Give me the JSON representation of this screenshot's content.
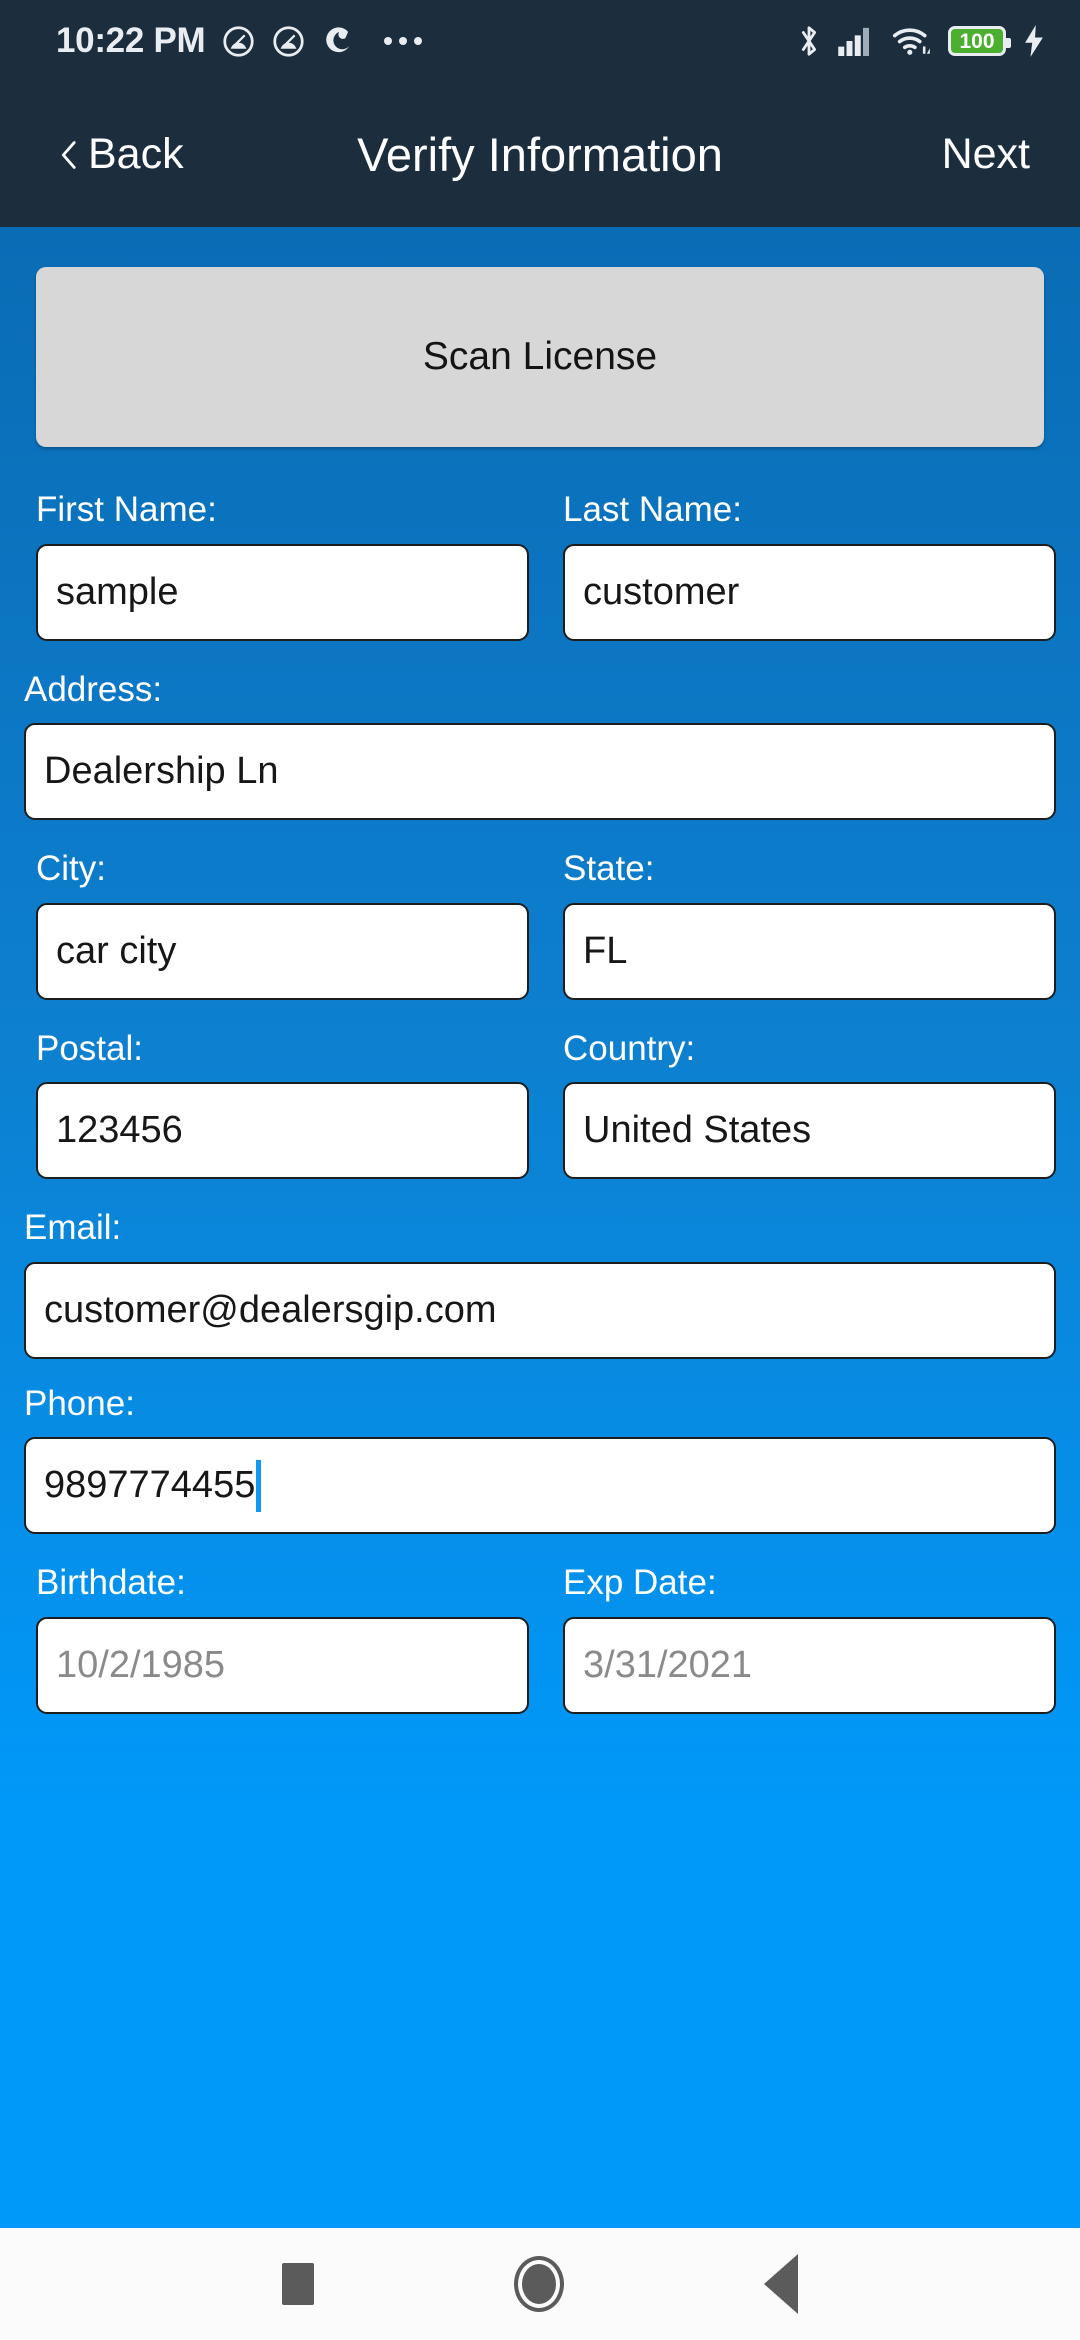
{
  "status_bar": {
    "time": "10:22 PM",
    "notification_icons": [
      "app-notification-icon",
      "app-notification-icon",
      "app-notification-icon"
    ],
    "overflow_icon": "more-dots-icon",
    "system_icons": [
      "bluetooth-icon",
      "cell-signal-icon",
      "wifi-icon"
    ],
    "battery_level": "100",
    "charging_icon": "charging-bolt-icon",
    "background_color": "#1c2e3d"
  },
  "nav_bar": {
    "back_label": "Back",
    "back_icon": "chevron-left-icon",
    "title": "Verify Information",
    "next_label": "Next",
    "background_color": "#1c2e3d"
  },
  "scan": {
    "label": "Scan License",
    "background_color": "#d7d7d7"
  },
  "theme": {
    "page_gradient_top": "#0a6cb5",
    "page_gradient_bottom": "#0099fa",
    "label_color": "#ffffff",
    "caret_color": "#0e9af2",
    "placeholder_color": "#8a8a8a"
  },
  "form": {
    "first_name": {
      "label": "First Name:",
      "value": "sample"
    },
    "last_name": {
      "label": "Last Name:",
      "value": "customer"
    },
    "address": {
      "label": "Address:",
      "value": "Dealership Ln"
    },
    "city": {
      "label": "City:",
      "value": "car city"
    },
    "state": {
      "label": "State:",
      "value": "FL"
    },
    "postal": {
      "label": "Postal:",
      "value": "123456"
    },
    "country": {
      "label": "Country:",
      "value": "United States"
    },
    "email": {
      "label": "Email:",
      "value": "customer@dealersgip.com"
    },
    "phone": {
      "label": "Phone:",
      "value": "9897774455",
      "focused": true
    },
    "birthdate": {
      "label": "Birthdate:",
      "value": "10/2/1985",
      "is_placeholder": true
    },
    "exp_date": {
      "label": "Exp Date:",
      "value": "3/31/2021",
      "is_placeholder": true
    }
  },
  "android_nav": {
    "recents_icon": "square-recents-icon",
    "home_icon": "circle-home-icon",
    "back_icon": "triangle-back-icon",
    "background_color": "#fbfbfb"
  }
}
